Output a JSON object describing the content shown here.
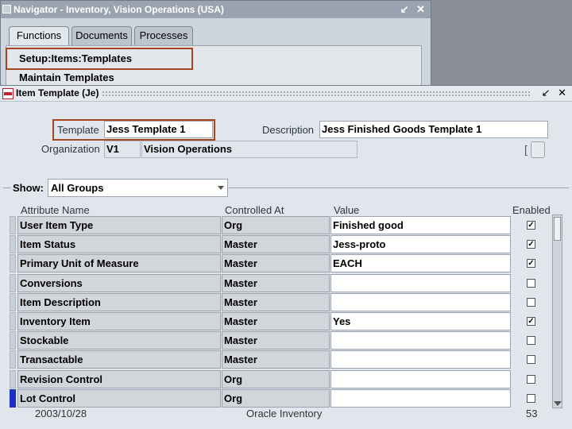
{
  "navigator": {
    "title": "Navigator - Inventory, Vision Operations (USA)",
    "window_controls": "↙ ✕",
    "tabs": [
      "Functions",
      "Documents",
      "Processes"
    ],
    "items": [
      "Setup:Items:Templates",
      "Maintain Templates"
    ]
  },
  "item_template": {
    "title": "Item Template (Je)",
    "window_controls": "↙ ✕",
    "template_label": "Template",
    "template_value": "Jess Template 1",
    "description_label": "Description",
    "description_value": "Jess Finished Goods Template 1",
    "organization_label": "Organization",
    "organization_code": "V1",
    "organization_name": "Vision Operations",
    "show_label": "Show:",
    "show_value": "All Groups",
    "columns": [
      "Attribute Name",
      "Controlled At",
      "Value",
      "Enabled"
    ],
    "rows": [
      {
        "attribute": "User Item Type",
        "controlled": "Org",
        "value": "Finished good",
        "enabled": true
      },
      {
        "attribute": "Item Status",
        "controlled": "Master",
        "value": "Jess-proto",
        "enabled": true
      },
      {
        "attribute": "Primary Unit of Measure",
        "controlled": "Master",
        "value": "EACH",
        "enabled": true
      },
      {
        "attribute": "Conversions",
        "controlled": "Master",
        "value": "",
        "enabled": false
      },
      {
        "attribute": "Item Description",
        "controlled": "Master",
        "value": "",
        "enabled": false
      },
      {
        "attribute": "Inventory Item",
        "controlled": "Master",
        "value": "Yes",
        "enabled": true
      },
      {
        "attribute": "Stockable",
        "controlled": "Master",
        "value": "",
        "enabled": false
      },
      {
        "attribute": "Transactable",
        "controlled": "Master",
        "value": "",
        "enabled": false
      },
      {
        "attribute": "Revision Control",
        "controlled": "Org",
        "value": "",
        "enabled": false
      },
      {
        "attribute": "Lot Control",
        "controlled": "Org",
        "value": "",
        "enabled": false
      }
    ]
  },
  "footer": {
    "date": "2003/10/28",
    "center": "Oracle Inventory",
    "page": "53"
  }
}
